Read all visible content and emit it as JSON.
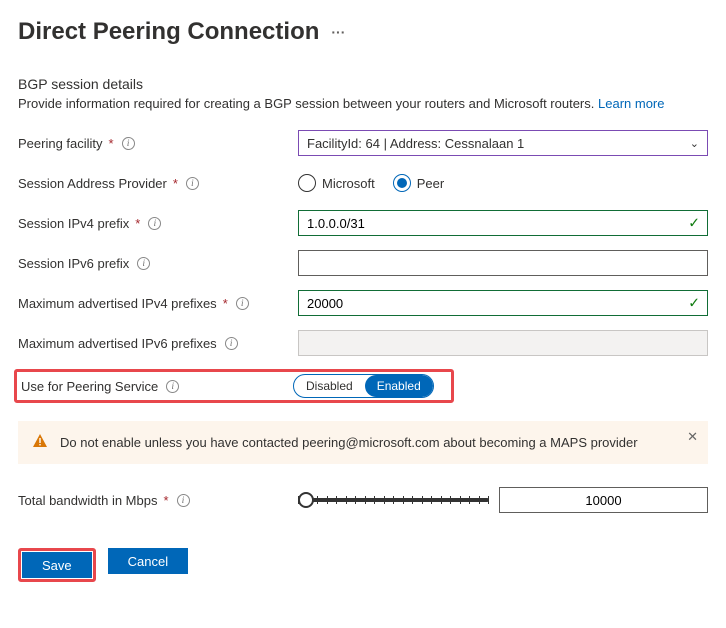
{
  "title": "Direct Peering Connection",
  "section": {
    "heading": "BGP session details",
    "sub": "Provide information required for creating a BGP session between your routers and Microsoft routers.",
    "learn_more": "Learn more"
  },
  "fields": {
    "facility": {
      "label": "Peering facility",
      "required": true,
      "value": "FacilityId: 64 | Address: Cessnalaan 1"
    },
    "provider": {
      "label": "Session Address Provider",
      "required": true,
      "options": [
        "Microsoft",
        "Peer"
      ],
      "selected": "Peer"
    },
    "ipv4": {
      "label": "Session IPv4 prefix",
      "required": true,
      "value": "1.0.0.0/31",
      "valid": true
    },
    "ipv6": {
      "label": "Session IPv6 prefix",
      "required": false,
      "value": ""
    },
    "max4": {
      "label": "Maximum advertised IPv4 prefixes",
      "required": true,
      "value": "20000",
      "valid": true
    },
    "max6": {
      "label": "Maximum advertised IPv6 prefixes",
      "required": false,
      "value": "",
      "disabled": true
    },
    "peering_service": {
      "label": "Use for Peering Service",
      "options": [
        "Disabled",
        "Enabled"
      ],
      "selected": "Enabled"
    },
    "bandwidth": {
      "label": "Total bandwidth in Mbps",
      "required": true,
      "value": "10000"
    }
  },
  "alert": {
    "text": "Do not enable unless you have contacted peering@microsoft.com about becoming a MAPS provider"
  },
  "buttons": {
    "save": "Save",
    "cancel": "Cancel"
  }
}
